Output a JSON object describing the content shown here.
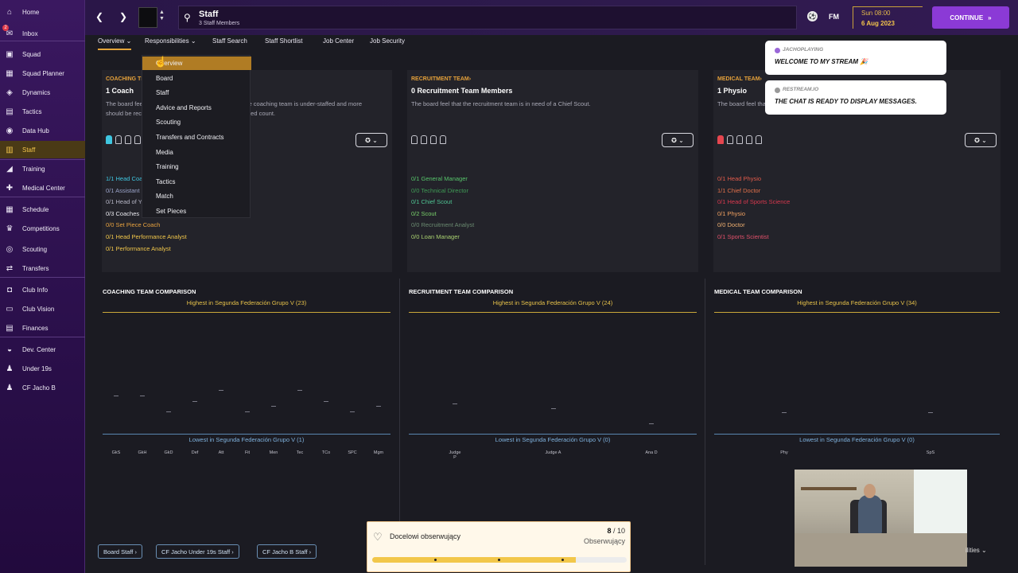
{
  "sidebar": {
    "items": [
      {
        "label": "Home",
        "icon": "home-icon",
        "glyph": "⌂"
      },
      {
        "label": "Inbox",
        "icon": "inbox-icon",
        "glyph": "✉",
        "badge": "2"
      },
      {
        "label": "Squad",
        "icon": "squad-icon",
        "glyph": "▣"
      },
      {
        "label": "Squad Planner",
        "icon": "squad-planner-icon",
        "glyph": "▦"
      },
      {
        "label": "Dynamics",
        "icon": "dynamics-icon",
        "glyph": "◈"
      },
      {
        "label": "Tactics",
        "icon": "tactics-icon",
        "glyph": "▤"
      },
      {
        "label": "Data Hub",
        "icon": "data-hub-icon",
        "glyph": "◉"
      },
      {
        "label": "Staff",
        "icon": "staff-icon",
        "glyph": "▥"
      },
      {
        "label": "Training",
        "icon": "training-icon",
        "glyph": "◢"
      },
      {
        "label": "Medical Center",
        "icon": "medical-icon",
        "glyph": "✚"
      },
      {
        "label": "Schedule",
        "icon": "schedule-icon",
        "glyph": "▦"
      },
      {
        "label": "Competitions",
        "icon": "trophy-icon",
        "glyph": "♛"
      },
      {
        "label": "Scouting",
        "icon": "scouting-icon",
        "glyph": "◎"
      },
      {
        "label": "Transfers",
        "icon": "transfers-icon",
        "glyph": "⇄"
      },
      {
        "label": "Club Info",
        "icon": "club-info-icon",
        "glyph": "◘"
      },
      {
        "label": "Club Vision",
        "icon": "club-vision-icon",
        "glyph": "▭"
      },
      {
        "label": "Finances",
        "icon": "finances-icon",
        "glyph": "▤"
      },
      {
        "label": "Dev. Center",
        "icon": "dev-center-icon",
        "glyph": "◒"
      },
      {
        "label": "Under 19s",
        "icon": "under19-icon",
        "glyph": "♟"
      },
      {
        "label": "CF Jacho B",
        "icon": "reserve-team-icon",
        "glyph": "♟"
      }
    ]
  },
  "header": {
    "title": "Staff",
    "subtitle": "3 Staff Members",
    "fm_label": "FM",
    "date_time": "Sun 08:00",
    "date": "6 Aug 2023",
    "continue_label": "CONTINUE"
  },
  "subnav": {
    "tabs": [
      "Overview",
      "Responsibilities",
      "Staff Search",
      "Staff Shortlist",
      "Job Center",
      "Job Security"
    ]
  },
  "dropdown": {
    "items": [
      "Overview",
      "Board",
      "Staff",
      "Advice and Reports",
      "Scouting",
      "Transfers and Contracts",
      "Media",
      "Training",
      "Tactics",
      "Match",
      "Set Pieces"
    ]
  },
  "panels": {
    "coaching": {
      "head": "COACHING TEAM",
      "title": "1 Coach",
      "desc": "The board feel that, with the current staff employed, the coaching team is under-staffed and more should be recruited to take it up to the minimum expected count.",
      "roles": [
        {
          "text": "1/1 Head Coach",
          "color": "#3fc6e0"
        },
        {
          "text": "0/1 Assistant Manager",
          "color": "#9aa3c8"
        },
        {
          "text": "0/1 Head of Youth Development",
          "color": "#b4b4c4"
        },
        {
          "text": "0/3 Coaches",
          "color": "#e8e8ee"
        },
        {
          "text": "0/0 Set Piece Coach",
          "color": "#e7a23f"
        },
        {
          "text": "0/1 Head Performance Analyst",
          "color": "#f0c64a"
        },
        {
          "text": "0/1 Performance Analyst",
          "color": "#f0c64a"
        }
      ]
    },
    "recruitment": {
      "head": "RECRUITMENT TEAM",
      "title": "0 Recruitment Team Members",
      "desc": "The board feel that the recruitment team is in need of a Chief Scout.",
      "roles": [
        {
          "text": "0/1 General Manager",
          "color": "#56c46a"
        },
        {
          "text": "0/0 Technical Director",
          "color": "#3f9a55"
        },
        {
          "text": "0/1 Chief Scout",
          "color": "#4fc493"
        },
        {
          "text": "0/2 Scout",
          "color": "#78d06a"
        },
        {
          "text": "0/0 Recruitment Analyst",
          "color": "#6a8a70"
        },
        {
          "text": "0/0 Loan Manager",
          "color": "#a8d070"
        }
      ]
    },
    "medical": {
      "head": "MEDICAL TEAM",
      "title": "1 Physio",
      "desc": "The board feel that the medical team",
      "roles": [
        {
          "text": "0/1 Head Physio",
          "color": "#e05a4a"
        },
        {
          "text": "1/1 Chief Doctor",
          "color": "#e0704a"
        },
        {
          "text": "0/1 Head of Sports Science",
          "color": "#d8384e"
        },
        {
          "text": "0/1 Physio",
          "color": "#f0a060"
        },
        {
          "text": "0/0 Doctor",
          "color": "#f0b070"
        },
        {
          "text": "0/1 Sports Scientist",
          "color": "#e0506a"
        }
      ]
    }
  },
  "comparisons": {
    "coaching": {
      "title": "COACHING TEAM COMPARISON",
      "highest": "Highest in Segunda Federación Grupo V (23)",
      "lowest": "Lowest in Segunda Federación Grupo V (1)",
      "labels": [
        "GkS",
        "GkH",
        "GkD",
        "Def",
        "Att",
        "Fit",
        "Men",
        "Tec",
        "TCo",
        "SPC",
        "Mgm"
      ],
      "values": [
        8,
        8,
        5,
        7,
        9,
        5,
        6,
        9,
        7,
        5,
        6
      ]
    },
    "recruitment": {
      "title": "RECRUITMENT TEAM COMPARISON",
      "highest": "Highest in Segunda Federación Grupo V (24)",
      "lowest": "Lowest in Segunda Federación Grupo V (0)",
      "labels": [
        "Judge P",
        "Judge A",
        "Ana D"
      ],
      "values": [
        6,
        5,
        2
      ]
    },
    "medical": {
      "title": "MEDICAL TEAM COMPARISON",
      "highest": "Highest in Segunda Federación Grupo V (34)",
      "lowest": "Lowest in Segunda Federación Grupo V (0)",
      "labels": [
        "Phy",
        "SpS"
      ],
      "values": [
        6,
        6
      ]
    }
  },
  "footer": {
    "buttons": [
      "Board Staff",
      "CF Jacho Under 19s Staff",
      "CF Jacho B Staff"
    ],
    "behind_text": "ilities"
  },
  "overlay": {
    "title": "Docelowi obserwujący",
    "count": "8",
    "total": "/ 10",
    "label": "Obserwujący",
    "progress": 0.8
  },
  "chat": [
    {
      "user": "JACHOPLAYING",
      "message": "WELCOME TO MY STREAM 🎉"
    },
    {
      "user": "RESTREAM.IO",
      "message": "THE CHAT IS READY TO DISPLAY MESSAGES."
    }
  ]
}
